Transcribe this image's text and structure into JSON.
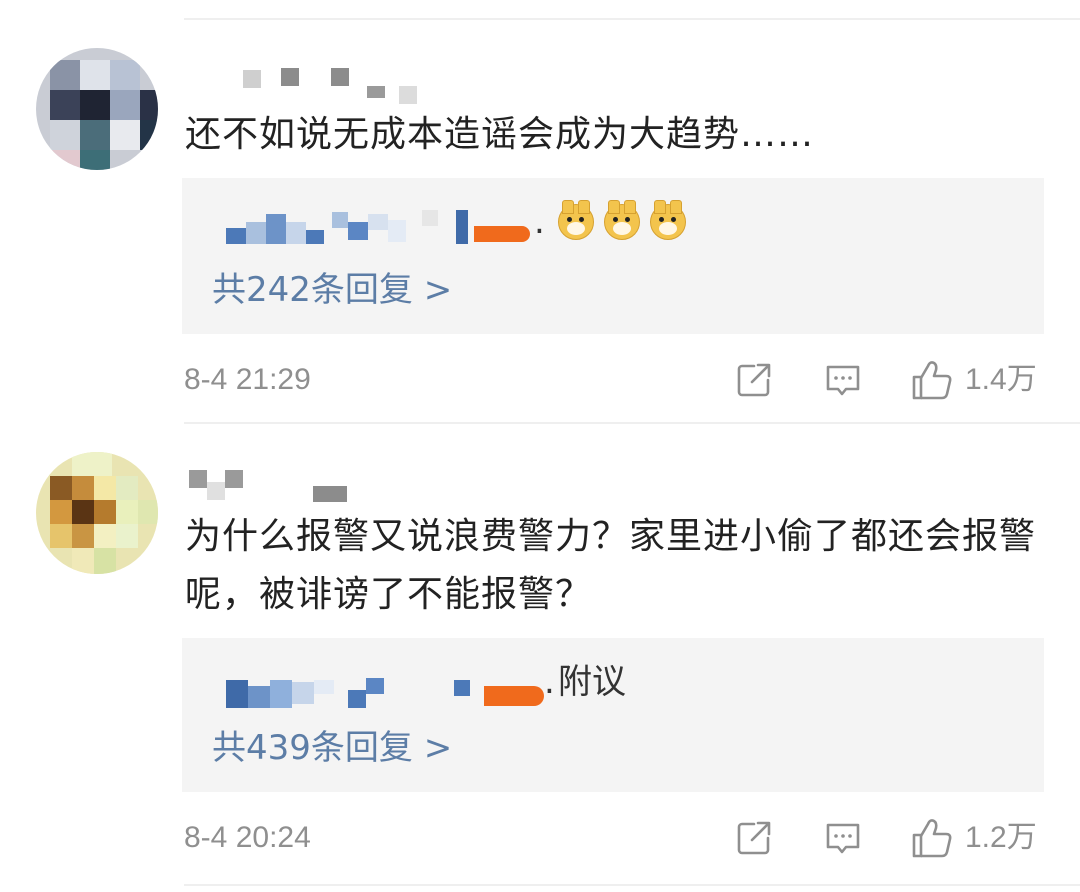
{
  "comments": [
    {
      "text": "还不如说无成本造谣会成为大趋势……",
      "reply_text": "",
      "reply_count_label": "共242条回复 >",
      "time": "8-4 21:29",
      "likes": "1.4万"
    },
    {
      "text": "为什么报警又说浪费警力？家里进小偷了都还会报警呢，被诽谤了不能报警？",
      "reply_text": "附议",
      "reply_count_label": "共439条回复 >",
      "time": "8-4 20:24",
      "likes": "1.2万"
    }
  ],
  "icons": {
    "share": "share-icon",
    "comment": "comment-icon",
    "like": "thumbs-up-icon",
    "emoji": "doge-emoji-icon"
  },
  "colors": {
    "reply_link": "#5c7da6",
    "meta_gray": "#8f8f8f",
    "reply_bg": "#f4f4f4",
    "mosaic_orange": "#f06a1c",
    "mosaic_blue": "#5b86c4"
  }
}
